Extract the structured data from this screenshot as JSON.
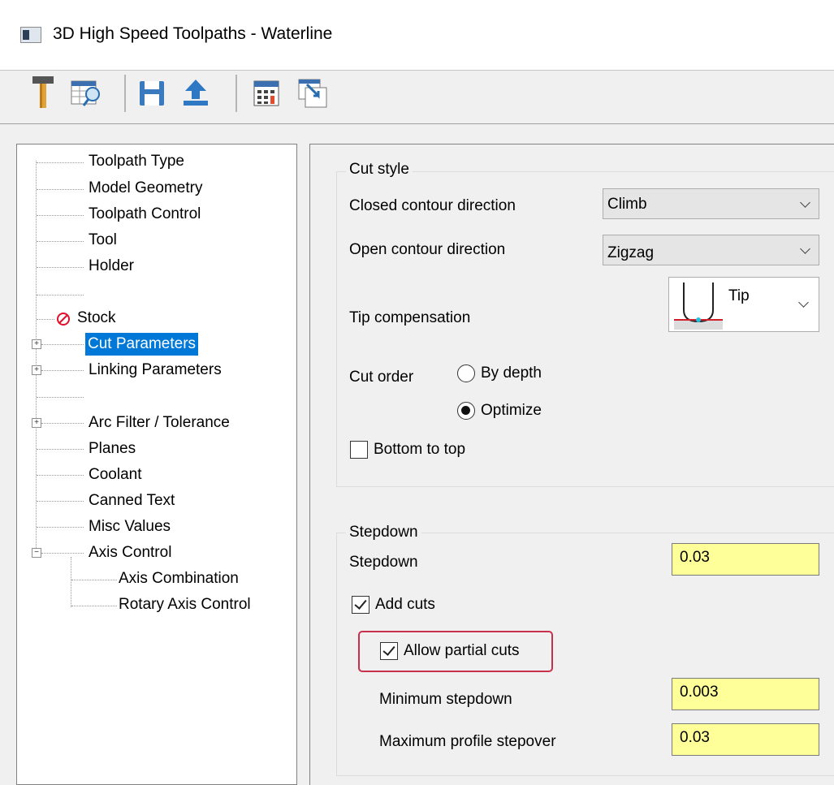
{
  "window": {
    "title": "3D High Speed Toolpaths - Waterline"
  },
  "toolbar": {
    "buttons": [
      {
        "name": "tool-icon"
      },
      {
        "name": "table-view-icon"
      },
      {
        "name": "save-icon"
      },
      {
        "name": "upload-icon"
      },
      {
        "name": "calculator-icon"
      },
      {
        "name": "window-arrow-icon"
      }
    ]
  },
  "tree": {
    "items": [
      {
        "label": "Toolpath Type"
      },
      {
        "label": "Model Geometry"
      },
      {
        "label": "Toolpath Control"
      },
      {
        "label": "Tool"
      },
      {
        "label": "Holder"
      },
      {
        "label": ""
      },
      {
        "label": "Stock"
      },
      {
        "label": "Cut Parameters",
        "selected": true
      },
      {
        "label": "Linking Parameters"
      },
      {
        "label": ""
      },
      {
        "label": "Arc Filter / Tolerance"
      },
      {
        "label": "Planes"
      },
      {
        "label": "Coolant"
      },
      {
        "label": "Canned Text"
      },
      {
        "label": "Misc Values"
      },
      {
        "label": "Axis Control"
      },
      {
        "label": "Axis Combination"
      },
      {
        "label": "Rotary Axis Control"
      }
    ]
  },
  "cut_style": {
    "group_title": "Cut style",
    "closed_label": "Closed contour direction",
    "closed_value": "Climb",
    "open_label": "Open contour direction",
    "open_value": "Zigzag",
    "tip_label": "Tip compensation",
    "tip_value": "Tip",
    "cut_order_label": "Cut order",
    "by_depth_label": "By depth",
    "optimize_label": "Optimize",
    "cut_order_selected": "Optimize",
    "bottom_to_top_label": "Bottom to top",
    "bottom_to_top_checked": false
  },
  "stepdown": {
    "group_title": "Stepdown",
    "stepdown_label": "Stepdown",
    "stepdown_value": "0.03",
    "add_cuts_label": "Add cuts",
    "add_cuts_checked": true,
    "allow_partial_label": "Allow partial cuts",
    "allow_partial_checked": true,
    "min_stepdown_label": "Minimum stepdown",
    "min_stepdown_value": "0.003",
    "max_profile_label": "Maximum profile stepover",
    "max_profile_value": "0.03"
  },
  "colors": {
    "selection": "#0078d7",
    "field_bg": "#ffff99",
    "highlight": "#c8304c"
  }
}
